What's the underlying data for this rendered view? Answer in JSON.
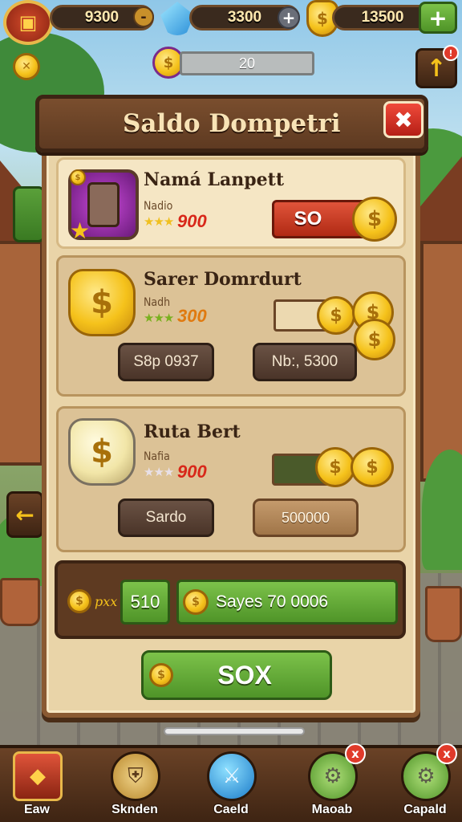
{
  "hud": {
    "gold_value": "9300",
    "gold_minus": "-",
    "gems_value": "3300",
    "gems_add": "+",
    "coins_value": "13500",
    "coins_add": "+",
    "progress_value": "20"
  },
  "dialog": {
    "title": "Saldo Dompetri",
    "close_label": "✖"
  },
  "cards": [
    {
      "name": "Namá Lanpett",
      "sub": "Nadio",
      "stars": "★★★",
      "rating": "900",
      "price": "SO"
    },
    {
      "name": "Sarer Domrdurt",
      "sub": "Nadh",
      "stars": "★★★",
      "rating": "300",
      "button_left": "S8p 0937",
      "button_right": "Nb:, 5300"
    },
    {
      "name": "Ruta Bert",
      "sub": "Nafia",
      "stars": "★★★",
      "rating": "900",
      "button_left": "Sardo",
      "button_right": "500000"
    }
  ],
  "summary": {
    "small_label": "pxx",
    "amount": "510",
    "wide_label": "Sayes 70 0006"
  },
  "confirm": {
    "label": "SOX"
  },
  "nav": [
    {
      "label": "Eaw"
    },
    {
      "label": "Sknden"
    },
    {
      "label": "Caeld"
    },
    {
      "label": "Maoab",
      "badge": "x"
    },
    {
      "label": "Capald",
      "badge": "x"
    }
  ],
  "icons": {
    "dollar": "$",
    "arrow_left": "←",
    "arrow_up": "↑",
    "badge_mark": "!"
  },
  "colors": {
    "accent_green": "#5fae32",
    "accent_red": "#d23a1f",
    "rating_red": "#d8281a",
    "rating_orange": "#e07a10"
  }
}
